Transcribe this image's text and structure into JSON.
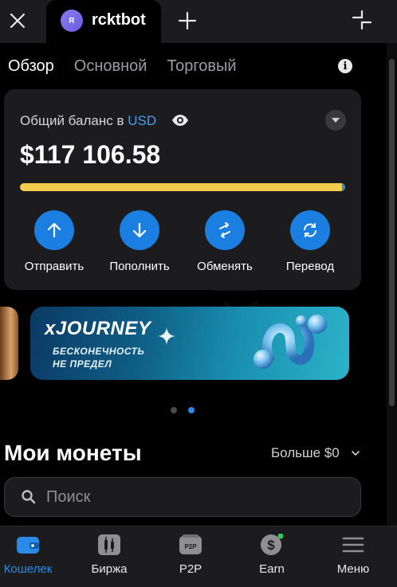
{
  "topbar": {
    "tab_avatar_letter": "R",
    "tab_title": "rcktbot"
  },
  "subtabs": [
    {
      "label": "Обзор",
      "active": true
    },
    {
      "label": "Основной",
      "active": false
    },
    {
      "label": "Торговый",
      "active": false
    }
  ],
  "info_glyph": "i",
  "balance": {
    "label_prefix": "Общий баланс в",
    "currency": "USD",
    "value": "$117 106.58"
  },
  "actions": [
    {
      "label": "Отправить",
      "icon": "arrow-up-icon"
    },
    {
      "label": "Пополнить",
      "icon": "arrow-down-icon"
    },
    {
      "label": "Обменять",
      "icon": "swap-icon"
    },
    {
      "label": "Перевод",
      "icon": "refresh-icon"
    }
  ],
  "banner": {
    "title": "xJOURNEY",
    "subtitle_line1": "БЕСКОНЕЧНОСТЬ",
    "subtitle_line2": "НЕ ПРЕДЕЛ"
  },
  "carousel": {
    "pages": 2,
    "active_index": 1
  },
  "coins": {
    "title": "Мои монеты",
    "more_label": "Больше $0"
  },
  "search": {
    "placeholder": "Поиск"
  },
  "bottom_nav": [
    {
      "label": "Кошелек",
      "icon": "wallet-icon",
      "active": true
    },
    {
      "label": "Биржа",
      "icon": "candles-icon",
      "active": false
    },
    {
      "label": "P2P",
      "icon": "p2p-icon",
      "active": false
    },
    {
      "label": "Earn",
      "icon": "earn-icon",
      "active": false
    },
    {
      "label": "Меню",
      "icon": "menu-icon",
      "active": false
    }
  ],
  "p2p_badge": "P2P",
  "colors": {
    "accent": "#1a7fe0",
    "balance_bar": "#f2cc4a",
    "background": "#000000",
    "card": "#1c1c1e",
    "earn_dot": "#34c759"
  }
}
